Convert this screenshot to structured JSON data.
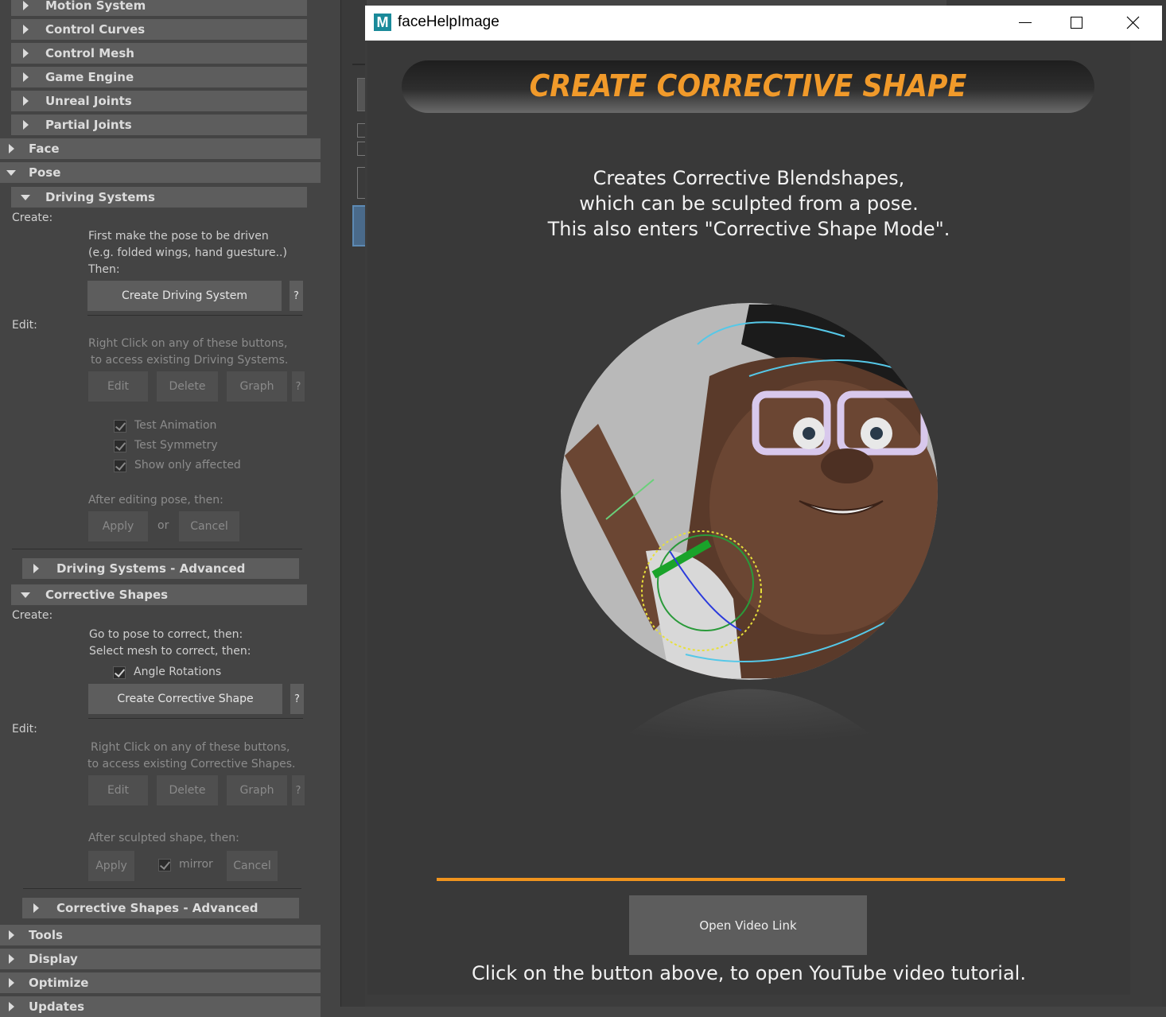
{
  "left_panel": {
    "sections": {
      "motion_system": "Motion System",
      "control_curves": "Control Curves",
      "control_mesh": "Control Mesh",
      "game_engine": "Game Engine",
      "unreal_joints": "Unreal Joints",
      "partial_joints": "Partial Joints",
      "face": "Face",
      "pose": "Pose",
      "tools": "Tools",
      "display": "Display",
      "optimize": "Optimize",
      "updates": "Updates"
    },
    "driving_systems": {
      "header": "Driving Systems",
      "create_label": "Create:",
      "instructions": [
        "First make the pose to be driven",
        "(e.g. folded wings, hand guesture..)",
        "Then:"
      ],
      "create_button": "Create Driving System",
      "help_button": "?",
      "edit_label": "Edit:",
      "edit_instructions": [
        "Right Click on any of these buttons,",
        "to access existing Driving Systems."
      ],
      "edit_button": "Edit",
      "delete_button": "Delete",
      "graph_button": "Graph",
      "edit_help_button": "?",
      "test_animation": "Test Animation",
      "test_symmetry": "Test Symmetry",
      "show_only_affected": "Show only affected",
      "after_label": "After editing pose, then:",
      "apply_button": "Apply",
      "or_label": "or",
      "cancel_button": "Cancel",
      "advanced_header": "Driving Systems - Advanced"
    },
    "corrective_shapes": {
      "header": "Corrective Shapes",
      "create_label": "Create:",
      "instructions": [
        "Go to pose to correct, then:",
        "Select mesh to correct, then:"
      ],
      "angle_rotations": "Angle Rotations",
      "create_button": "Create Corrective Shape",
      "help_button": "?",
      "edit_label": "Edit:",
      "edit_instructions": [
        "Right Click on any of these buttons,",
        "to access existing Corrective Shapes."
      ],
      "edit_button": "Edit",
      "delete_button": "Delete",
      "graph_button": "Graph",
      "edit_help_button": "?",
      "after_label": "After sculpted shape, then:",
      "apply_button": "Apply",
      "mirror_label": "mirror",
      "cancel_button": "Cancel",
      "advanced_header": "Corrective Shapes - Advanced"
    }
  },
  "dialog": {
    "title": "faceHelpImage",
    "app_icon_letter": "M",
    "controls": {
      "minimize_icon": "minimize-icon",
      "maximize_icon": "maximize-icon",
      "close_icon": "close-icon"
    },
    "banner_title": "CREATE CORRECTIVE SHAPE",
    "description": [
      "Creates Corrective Blendshapes,",
      "which can be sculpted from a pose.",
      "This also enters \"Corrective Shape Mode\"."
    ],
    "video_button": "Open Video Link",
    "footer_text": "Click on the button above, to open YouTube video tutorial.",
    "colors": {
      "accent_orange": "#f0941e",
      "banner_text": "#f19a2a"
    }
  }
}
